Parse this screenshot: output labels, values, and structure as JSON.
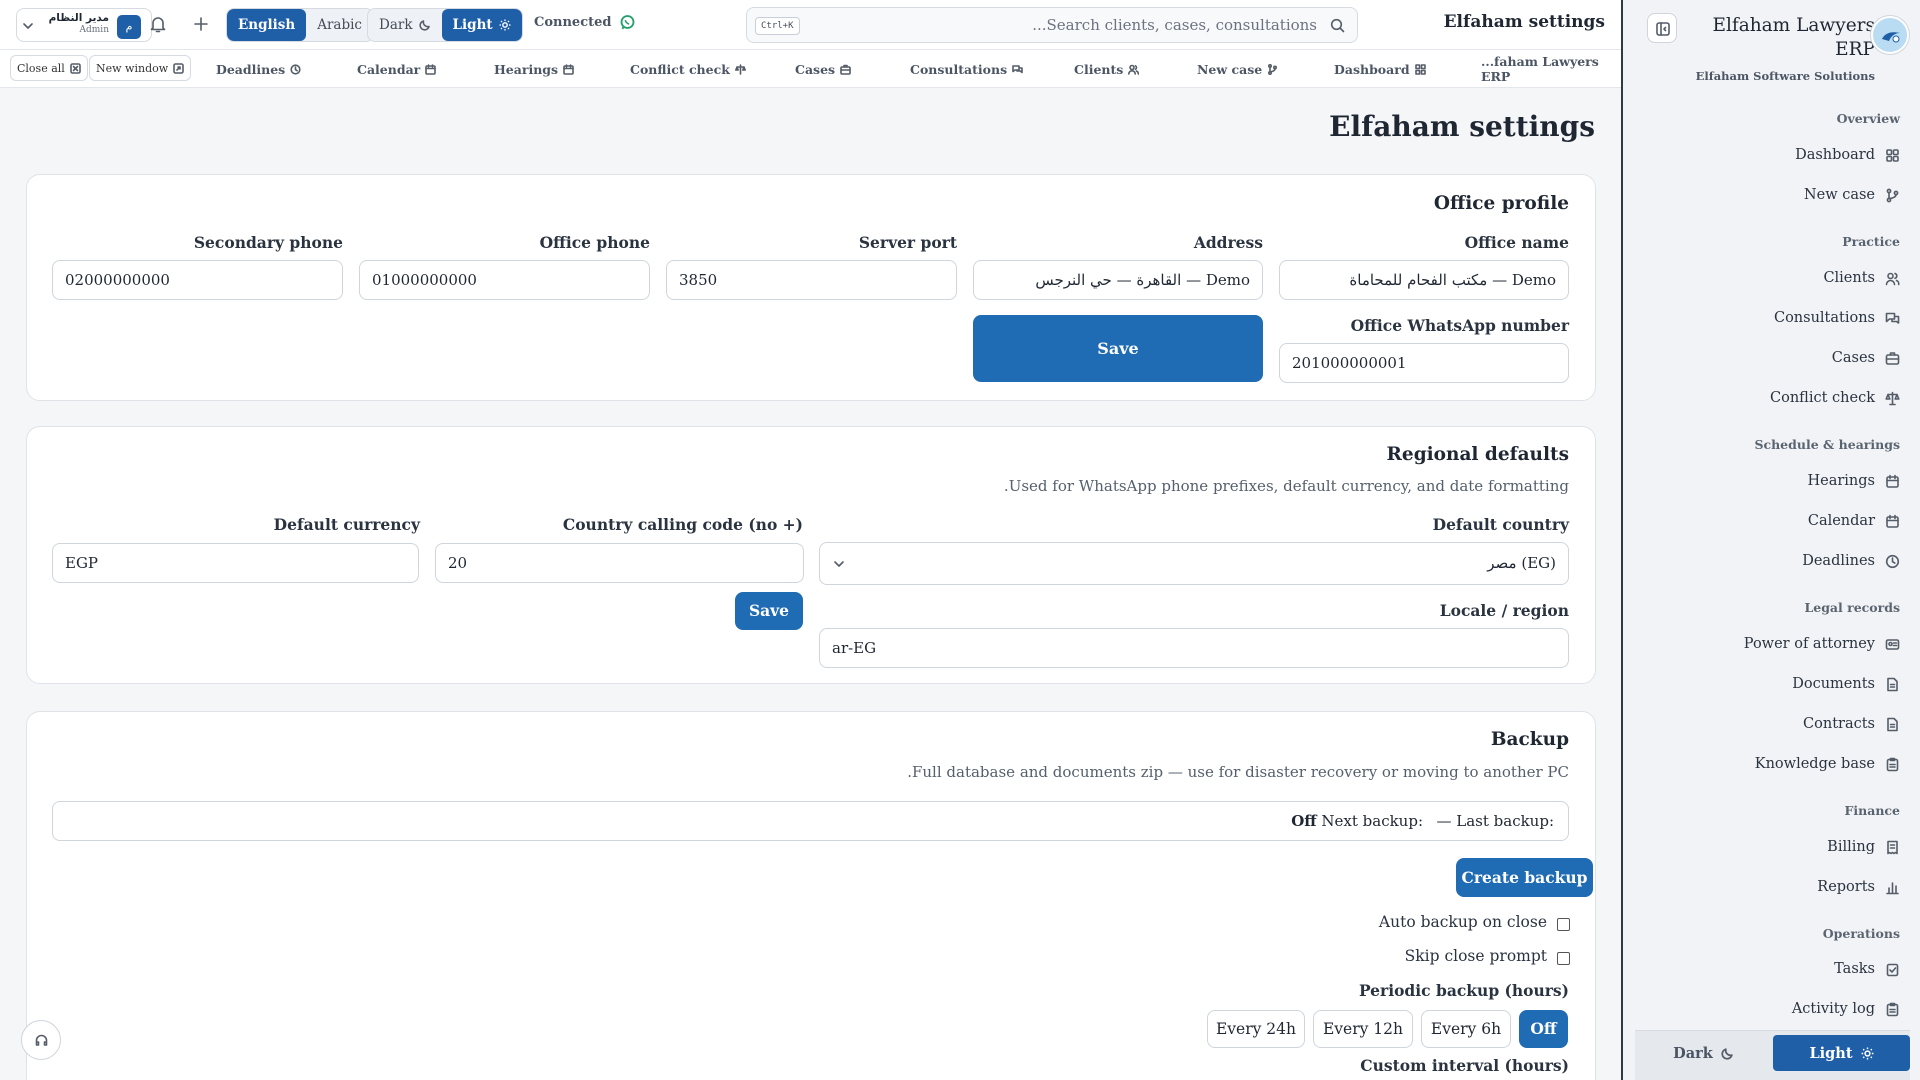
{
  "header": {
    "user_name": "مدير النظام",
    "user_role": "Admin",
    "user_initial": "م",
    "lang_english": "English",
    "lang_arabic": "Arabic",
    "theme_dark": "Dark",
    "theme_light": "Light",
    "connection_status": "Connected",
    "search_shortcut": "Ctrl+K",
    "search_placeholder": "...Search clients, cases, consultations",
    "page_title": "Elfaham settings"
  },
  "tabs": {
    "close_all": "Close all",
    "new_window": "New window",
    "items": [
      "Deadlines",
      "Calendar",
      "Hearings",
      "Conflict check",
      "Cases",
      "Consultations",
      "Clients",
      "New case",
      "Dashboard",
      "...faham Lawyers ERP"
    ]
  },
  "main": {
    "title": "Elfaham settings",
    "office_profile": {
      "heading": "Office profile",
      "office_name_label": "Office name",
      "office_name_value": "مكتب الفحام للمحاماة — Demo",
      "address_label": "Address",
      "address_value": "القاهرة — حي النرجس — Demo",
      "server_port_label": "Server port",
      "server_port_value": "3850",
      "office_phone_label": "Office phone",
      "office_phone_value": "01000000000",
      "secondary_phone_label": "Secondary phone",
      "secondary_phone_value": "02000000000",
      "whatsapp_label": "Office WhatsApp number",
      "whatsapp_value": "201000000001",
      "save_label": "Save"
    },
    "regional": {
      "heading": "Regional defaults",
      "description": ".Used for WhatsApp phone prefixes, default currency, and date formatting",
      "country_label": "Default country",
      "country_value": "مصر (EG)",
      "calling_code_label": "Country calling code (no +)",
      "calling_code_value": "20",
      "currency_label": "Default currency",
      "currency_value": "EGP",
      "locale_label": "Locale / region",
      "locale_value": "ar-EG",
      "save_label": "Save"
    },
    "backup": {
      "heading": "Backup",
      "description": ".Full database and documents zip — use for disaster recovery or moving to another PC",
      "last_backup_label": "Last backup:",
      "last_backup_value": "—",
      "next_backup_label": "Next backup:",
      "next_backup_value": "Off",
      "create_label": "Create backup",
      "auto_backup_label": "Auto backup on close",
      "skip_prompt_label": "Skip close prompt",
      "periodic_label": "Periodic backup (hours)",
      "periodic_options": [
        "Off",
        "Every 6h",
        "Every 12h",
        "Every 24h"
      ],
      "periodic_selected": "Off",
      "custom_label": "Custom interval (hours)"
    }
  },
  "sidebar": {
    "brand_title": "Elfaham Lawyers ERP",
    "brand_subtitle": "Elfaham Software Solutions",
    "sections": [
      {
        "title": "Overview",
        "items": [
          "Dashboard",
          "New case"
        ]
      },
      {
        "title": "Practice",
        "items": [
          "Clients",
          "Consultations",
          "Cases",
          "Conflict check"
        ]
      },
      {
        "title": "Schedule & hearings",
        "items": [
          "Hearings",
          "Calendar",
          "Deadlines"
        ]
      },
      {
        "title": "Legal records",
        "items": [
          "Power of attorney",
          "Documents",
          "Contracts",
          "Knowledge base"
        ]
      },
      {
        "title": "Finance",
        "items": [
          "Billing",
          "Reports"
        ]
      },
      {
        "title": "Operations",
        "items": [
          "Tasks",
          "Activity log"
        ]
      }
    ],
    "theme_dark": "Dark",
    "theme_light": "Light"
  },
  "colors": {
    "accent": "#1f6bb4",
    "sidebar_border": "#2f3a48",
    "connected": "#22a06b"
  }
}
